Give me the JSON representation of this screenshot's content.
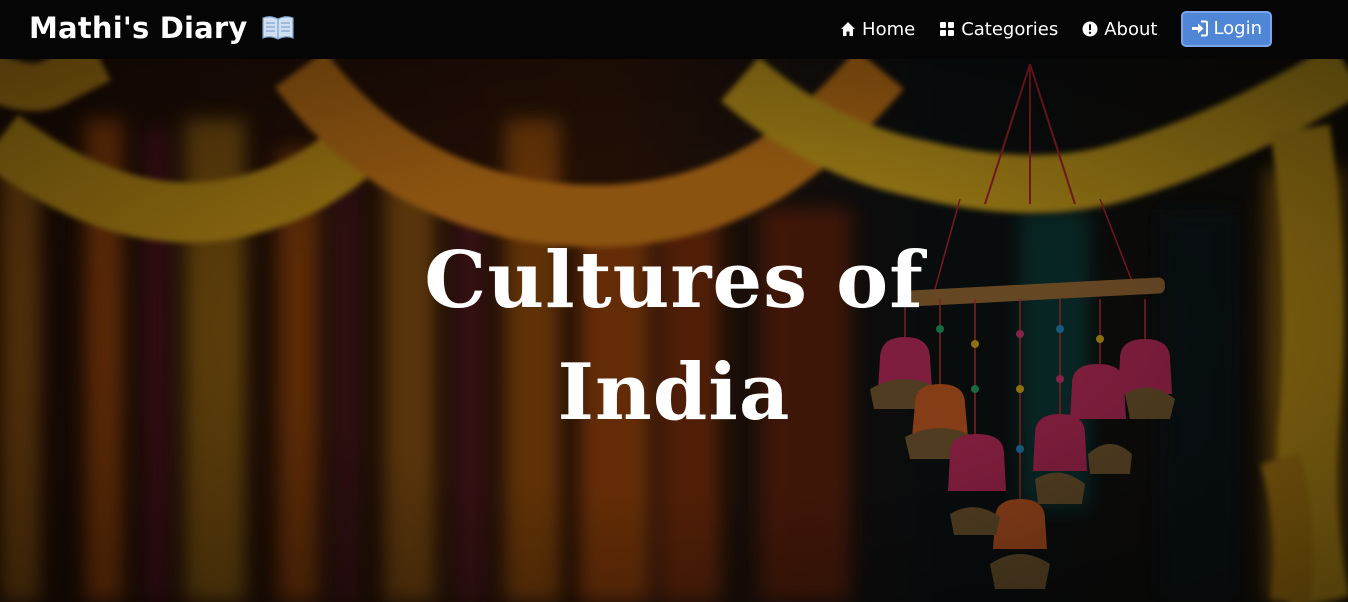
{
  "navbar": {
    "brand": "Mathi's Diary",
    "brand_icon": "open-book-icon",
    "links": [
      {
        "label": "Home",
        "icon": "home-icon"
      },
      {
        "label": "Categories",
        "icon": "grid-icon"
      },
      {
        "label": "About",
        "icon": "info-icon"
      }
    ],
    "login": {
      "label": "Login",
      "icon": "sign-in-icon"
    }
  },
  "hero": {
    "title": "Cultures of India"
  },
  "colors": {
    "navbar_bg": "#050505",
    "login_bg": "#4f86d6",
    "marigold": "#f5b81c",
    "marigold_orange": "#f08a1c"
  }
}
